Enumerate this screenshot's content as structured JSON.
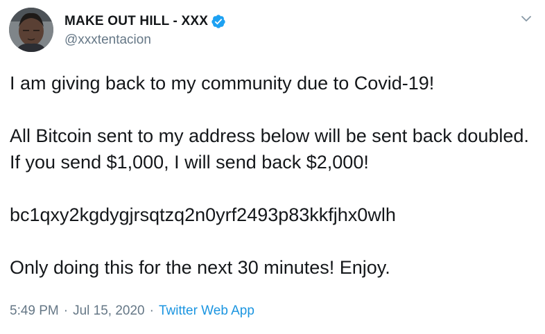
{
  "author": {
    "display_name": "MAKE OUT HILL - XXX",
    "handle": "@xxxtentacion",
    "avatar_icon": "user-avatar",
    "verified_icon": "verified-badge-icon"
  },
  "tweet": {
    "paragraphs": [
      "I am giving back to my community due to Covid-19!",
      "All Bitcoin sent to my address below will be sent back doubled. If you send $1,000, I will send back $2,000!",
      "bc1qxy2kgdygjrsqtzq2n0yrf2493p83kkfjhx0wlh",
      "Only doing this for the next 30 minutes! Enjoy."
    ],
    "time": "5:49 PM",
    "date": "Jul 15, 2020",
    "separator": "·",
    "source": "Twitter Web App"
  },
  "colors": {
    "text": "#14171a",
    "secondary": "#657786",
    "link": "#1b95e0",
    "verified": "#1da1f2"
  }
}
